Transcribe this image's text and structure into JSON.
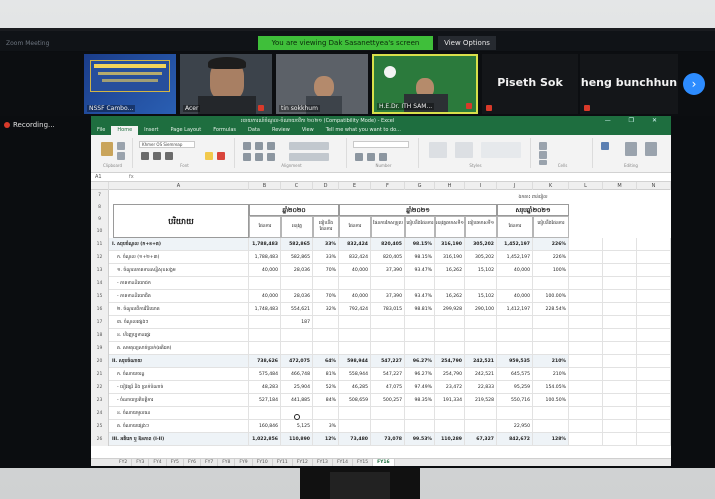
{
  "zoom": {
    "meeting_label": "Zoom Meeting",
    "banner_text": "You are viewing Dak Sasanettyea's screen",
    "view_options_label": "View Options",
    "recording_label": "Recording...",
    "next_icon": "chevron-right-icon",
    "participants": [
      {
        "name": "NSSF Cambo...",
        "type": "video"
      },
      {
        "name": "Acer",
        "type": "video"
      },
      {
        "name": "tin sokkhum",
        "type": "video"
      },
      {
        "name": "H.E.Dr. ITH SAM...",
        "type": "video"
      },
      {
        "name": "Piseth Sok",
        "type": "name-only"
      },
      {
        "name": "heng bunchhun",
        "type": "name-only"
      }
    ]
  },
  "excel": {
    "title": "របាយការណ៍ចំណូល-ចំណាយថវិកា ២០២១ (Compatibility Mode) - Excel",
    "window_controls": "— ❐ ✕",
    "tabs": [
      "File",
      "Home",
      "Insert",
      "Page Layout",
      "Formulas",
      "Data",
      "Review",
      "View",
      "Tell me what you want to do..."
    ],
    "active_tab": "Home",
    "ribbon_groups": [
      "Clipboard",
      "Font",
      "Alignment",
      "Number",
      "Styles",
      "Cells",
      "Editing"
    ],
    "font_name": "Khmer OS Siemreap",
    "name_box": "A1",
    "formula_icon": "fx",
    "columns": [
      "A",
      "B",
      "C",
      "D",
      "E",
      "F",
      "G",
      "H",
      "I",
      "J",
      "K",
      "L",
      "M",
      "N"
    ],
    "header_main": "បរិយាយ",
    "header_groups": [
      "ឆ្នាំ២០២០",
      "ឆ្នាំ២០២១",
      "សរុបឆ្នាំ២០២១"
    ],
    "header_note": "ឯកតា៖ ពាន់រៀល",
    "sub_headers": [
      "ផែនការ",
      "អនុវត្ត",
      "ធៀបនឹងផែនការ",
      "ផែនការ",
      "ផែនការកែសម្រួល",
      "ធៀបនឹងផែនការ",
      "អនុវត្តឆមាសទី១",
      "ធៀបឆមាសទី១",
      "ផែនការ",
      "ធៀបនឹងផែនការ"
    ],
    "rows": [
      {
        "num": "11",
        "label": "I. សរុបចំណូល (ក+ខ+គ)",
        "vals": [
          "1,788,483",
          "582,865",
          "33%",
          "832,424",
          "820,405",
          "98.15%",
          "316,190",
          "305,202",
          "1,452,197",
          "226%"
        ],
        "bold": true
      },
      {
        "num": "12",
        "label": "ក. ចំណូល (១+២+៣)",
        "vals": [
          "1,788,483",
          "582,865",
          "33%",
          "832,424",
          "820,405",
          "98.15%",
          "316,190",
          "305,202",
          "1,452,197",
          "226%"
        ],
        "bold": false
      },
      {
        "num": "13",
        "label": "១. ចំណូលភាគទានសន្តិសុខសង្គម",
        "vals": [
          "40,000",
          "28,036",
          "70%",
          "40,000",
          "37,390",
          "93.47%",
          "16,262",
          "15,102",
          "40,000",
          "100%"
        ],
        "bold": false
      },
      {
        "num": "14",
        "label": "- ភាគទាននិយោជក",
        "vals": [
          "",
          "",
          "",
          "",
          "",
          "",
          "",
          "",
          "",
          ""
        ],
        "bold": false
      },
      {
        "num": "15",
        "label": "- ភាគទាននិយោជិត",
        "vals": [
          "40,000",
          "28,036",
          "70%",
          "40,000",
          "37,390",
          "93.47%",
          "16,262",
          "15,102",
          "40,000",
          "100.00%"
        ],
        "bold": false
      },
      {
        "num": "16",
        "label": "២. ចំណូលពីការវិនិយោគ",
        "vals": [
          "1,748,483",
          "554,621",
          "32%",
          "792,424",
          "783,015",
          "98.81%",
          "299,928",
          "290,100",
          "1,412,197",
          "228.54%"
        ],
        "bold": false
      },
      {
        "num": "17",
        "label": "៣. ចំណូលផ្សេងៗ",
        "vals": [
          "",
          "187",
          "",
          "",
          "",
          "",
          "",
          "",
          "",
          ""
        ],
        "bold": false
      },
      {
        "num": "18",
        "label": "ខ. ហិរញ្ញប្បទានផ្ទេរ",
        "vals": [
          "",
          "",
          "",
          "",
          "",
          "",
          "",
          "",
          "",
          ""
        ],
        "bold": false
      },
      {
        "num": "19",
        "label": "គ. សមតុល្យសាច់ប្រាក់(អតិរេក)",
        "vals": [
          "",
          "",
          "",
          "",
          "",
          "",
          "",
          "",
          "",
          ""
        ],
        "bold": false
      },
      {
        "num": "20",
        "label": "II. សរុបចំណាយ",
        "vals": [
          "738,626",
          "472,075",
          "64%",
          "598,944",
          "547,227",
          "96.27%",
          "254,790",
          "242,521",
          "959,535",
          "210%"
        ],
        "bold": true
      },
      {
        "num": "21",
        "label": "ក. ចំណាយចរន្ត",
        "vals": [
          "575,484",
          "466,748",
          "81%",
          "558,944",
          "547,227",
          "96.27%",
          "254,790",
          "242,521",
          "645,575",
          "210%"
        ],
        "bold": false
      },
      {
        "num": "22",
        "label": "- បៀវត្សរ៍ និង ប្រាក់បំណាច់",
        "vals": [
          "48,283",
          "25,904",
          "52%",
          "46,285",
          "47,075",
          "97.49%",
          "23,472",
          "22,833",
          "95,259",
          "154.05%"
        ],
        "bold": false
      },
      {
        "num": "23",
        "label": "- ចំណាយប្រតិបត្តិការ",
        "vals": [
          "527,184",
          "441,885",
          "84%",
          "508,659",
          "500,257",
          "98.35%",
          "191,334",
          "219,528",
          "550,716",
          "100.50%"
        ],
        "bold": false
      },
      {
        "num": "24",
        "label": "ខ. ចំណាយមូលធន",
        "vals": [
          "",
          "",
          "",
          "",
          "",
          "",
          "",
          "",
          "",
          ""
        ],
        "bold": false
      },
      {
        "num": "25",
        "label": "គ. ចំណាយផ្សេងៗ",
        "vals": [
          "160,846",
          "5,125",
          "3%",
          "",
          "",
          "",
          "",
          "",
          "22,950",
          ""
        ],
        "bold": false
      },
      {
        "num": "26",
        "label": "III. អតិរេក ឬ ឱនភាព (I-II)",
        "vals": [
          "1,022,856",
          "110,890",
          "12%",
          "73,480",
          "73,078",
          "99.53%",
          "110,289",
          "67,327",
          "842,672",
          "128%"
        ],
        "bold": true
      }
    ],
    "sheet_tabs": [
      "FY2",
      "FY3",
      "FY4",
      "FY5",
      "FY6",
      "FY7",
      "FY8",
      "FY9",
      "FY10",
      "FY11",
      "FY12",
      "FY13",
      "FY14",
      "FY15",
      "FY16"
    ],
    "active_sheet": "FY16"
  }
}
